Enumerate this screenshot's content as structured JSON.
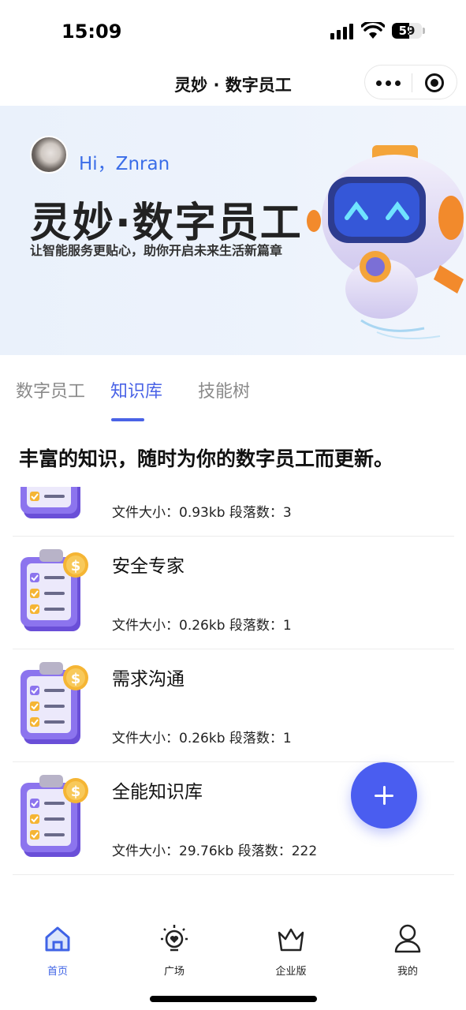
{
  "status_bar": {
    "time": "15:09",
    "battery": "59",
    "battery_level": 0.59
  },
  "nav": {
    "title": "灵妙 · 数字员工",
    "more_icon": "more-dots-icon",
    "close_icon": "target-close-icon"
  },
  "banner": {
    "greeting": "Hi，Znran",
    "title": "灵妙·数字员工",
    "subtitle": "让智能服务更贴心，助你开启未来生活新篇章"
  },
  "tabs": [
    {
      "label": "数字员工",
      "active": false
    },
    {
      "label": "知识库",
      "active": true
    },
    {
      "label": "技能树",
      "active": false
    }
  ],
  "section_heading": "丰富的知识，随时为你的数字员工而更新。",
  "knowledge_items": [
    {
      "name": "",
      "meta": "文件大小：0.93kb   段落数：3"
    },
    {
      "name": "安全专家",
      "meta": "文件大小：0.26kb   段落数：1"
    },
    {
      "name": "需求沟通",
      "meta": "文件大小：0.26kb   段落数：1"
    },
    {
      "name": "全能知识库",
      "meta": "文件大小：29.76kb   段落数：222"
    }
  ],
  "fab_icon": "plus-icon",
  "tabbar": [
    {
      "label": "首页",
      "icon": "home-icon",
      "active": true
    },
    {
      "label": "广场",
      "icon": "bulb-heart-icon",
      "active": false
    },
    {
      "label": "企业版",
      "icon": "crown-icon",
      "active": false
    },
    {
      "label": "我的",
      "icon": "user-icon",
      "active": false
    }
  ],
  "colors": {
    "accent": "#4a63e6",
    "fab": "#4a5df0",
    "banner_bg": "#eaf1fb",
    "greeting": "#3a6de8"
  }
}
